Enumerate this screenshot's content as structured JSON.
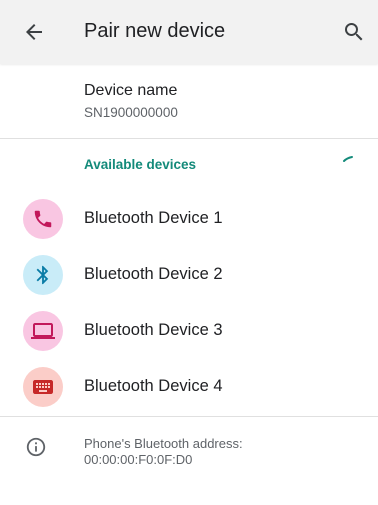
{
  "app_bar": {
    "title": "Pair new device",
    "back_icon": "arrow-back-icon",
    "search_icon": "search-icon"
  },
  "device_name": {
    "label": "Device name",
    "value": "SN1900000000"
  },
  "available_devices": {
    "header": "Available devices",
    "devices": [
      {
        "label": "Bluetooth Device 1",
        "icon": "phone-icon",
        "bg": "#f9c6e2",
        "fg": "#c2185b"
      },
      {
        "label": "Bluetooth Device 2",
        "icon": "bluetooth-icon",
        "bg": "#c9ecf8",
        "fg": "#0a7ca6"
      },
      {
        "label": "Bluetooth Device 3",
        "icon": "laptop-icon",
        "bg": "#f9c6e2",
        "fg": "#c2185b"
      },
      {
        "label": "Bluetooth Device 4",
        "icon": "keyboard-icon",
        "bg": "#fbcdc8",
        "fg": "#c62828"
      }
    ]
  },
  "footer": {
    "icon": "info-icon",
    "text": "Phone's Bluetooth address: 00:00:00:F0:0F:D0"
  },
  "colors": {
    "accent": "#138a7a",
    "app_bar_bg": "#f2f2f2"
  }
}
